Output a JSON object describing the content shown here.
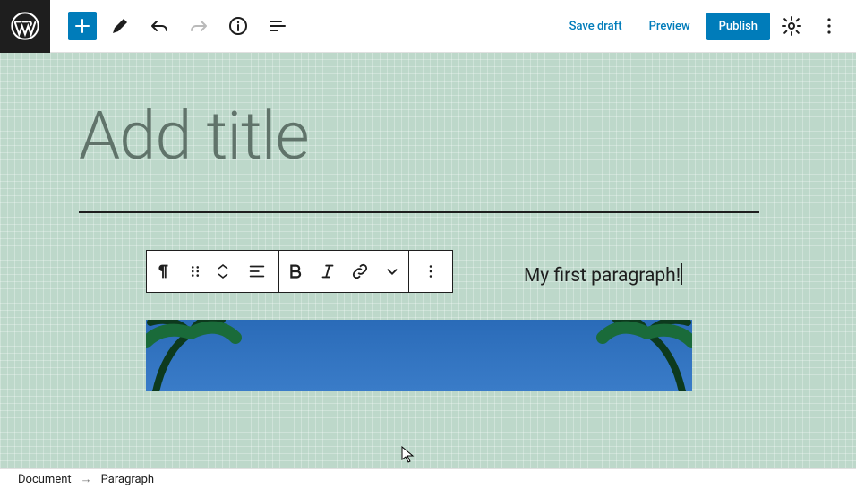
{
  "header": {
    "save_draft": "Save draft",
    "preview": "Preview",
    "publish": "Publish"
  },
  "editor": {
    "title_placeholder": "Add title",
    "paragraph_text": "My first paragraph!"
  },
  "breadcrumb": {
    "root": "Document",
    "current": "Paragraph"
  },
  "colors": {
    "accent": "#007cba",
    "canvas_bg": "#bdd8ca"
  }
}
